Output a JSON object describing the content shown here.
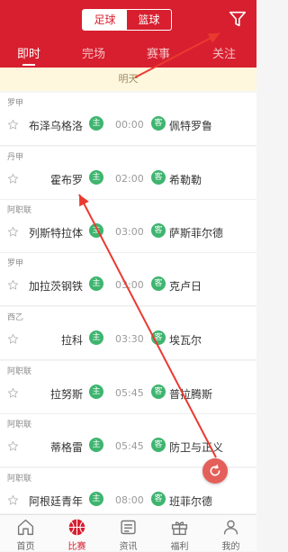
{
  "header": {
    "sport_toggle": {
      "active": "足球",
      "inactive": "篮球"
    },
    "filter_icon": "filter-icon",
    "colors": {
      "brand": "#d81f2f",
      "accent_green": "#3eb56f",
      "refresh": "#e45f5a"
    }
  },
  "tabs": [
    {
      "label": "即时",
      "active": true
    },
    {
      "label": "完场",
      "active": false
    },
    {
      "label": "赛事",
      "active": false
    },
    {
      "label": "关注",
      "active": false
    }
  ],
  "day_banner": "明天",
  "matches": [
    {
      "league": "罗甲",
      "home": "布泽乌格洛",
      "home_badge": "主",
      "time": "00:00",
      "away_badge": "客",
      "away": "佩特罗鲁"
    },
    {
      "league": "丹甲",
      "home": "霍布罗",
      "home_badge": "主",
      "time": "02:00",
      "away_badge": "客",
      "away": "希勒勒"
    },
    {
      "league": "阿职联",
      "home": "列斯特拉体",
      "home_badge": "主",
      "time": "03:00",
      "away_badge": "客",
      "away": "萨斯菲尔德"
    },
    {
      "league": "罗甲",
      "home": "加拉茨钢铁",
      "home_badge": "主",
      "time": "03:00",
      "away_badge": "客",
      "away": "克卢日"
    },
    {
      "league": "西乙",
      "home": "拉科",
      "home_badge": "主",
      "time": "03:30",
      "away_badge": "客",
      "away": "埃瓦尔"
    },
    {
      "league": "阿职联",
      "home": "拉努斯",
      "home_badge": "主",
      "time": "05:45",
      "away_badge": "客",
      "away": "普拉腾斯"
    },
    {
      "league": "阿职联",
      "home": "蒂格雷",
      "home_badge": "主",
      "time": "05:45",
      "away_badge": "客",
      "away": "防卫与正义"
    },
    {
      "league": "阿职联",
      "home": "阿根廷青年",
      "home_badge": "主",
      "time": "08:00",
      "away_badge": "客",
      "away": "班菲尔德"
    }
  ],
  "bottom_nav": [
    {
      "label": "首页",
      "icon": "home-icon",
      "active": false
    },
    {
      "label": "比赛",
      "icon": "basketball-icon",
      "active": true
    },
    {
      "label": "资讯",
      "icon": "news-icon",
      "active": false
    },
    {
      "label": "福利",
      "icon": "gift-icon",
      "active": false
    },
    {
      "label": "我的",
      "icon": "user-icon",
      "active": false
    }
  ]
}
